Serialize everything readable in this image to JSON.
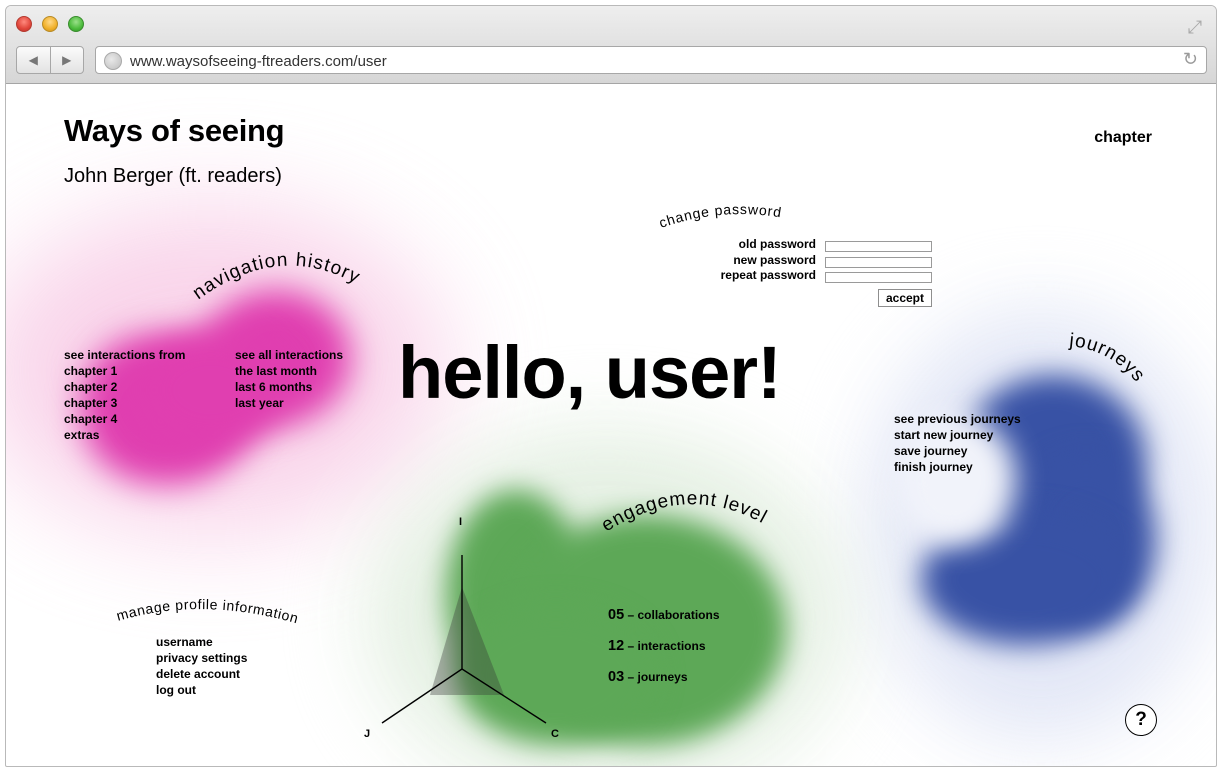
{
  "browser": {
    "url": "www.waysofseeing-ftreaders.com/user",
    "back_icon": "back-arrow-icon",
    "forward_icon": "forward-arrow-icon",
    "reload_icon": "reload-icon"
  },
  "site": {
    "title": "Ways of seeing",
    "subtitle": "John Berger (ft. readers)",
    "chapter_link": "chapter"
  },
  "greeting": "hello, user!",
  "navigation_history": {
    "heading": "navigation history",
    "from_label": "see interactions from",
    "chapters": [
      "chapter 1",
      "chapter 2",
      "chapter 3",
      "chapter 4",
      "extras"
    ],
    "all_label": "see all interactions",
    "periods": [
      "the last month",
      "last 6 months",
      "last year"
    ],
    "color": "#e03fb0"
  },
  "change_password": {
    "heading": "change password",
    "old_label": "old password",
    "new_label": "new password",
    "repeat_label": "repeat password",
    "accept_label": "accept"
  },
  "journeys": {
    "heading": "journeys",
    "items": [
      "see previous journeys",
      "start new journey",
      "save journey",
      "finish journey"
    ],
    "color": "#3852a5"
  },
  "engagement_level": {
    "heading": "engagement level",
    "stats": [
      {
        "value": "05",
        "label": "– collaborations"
      },
      {
        "value": "12",
        "label": "– interactions"
      },
      {
        "value": "03",
        "label": "– journeys"
      }
    ],
    "axes": [
      "I",
      "J",
      "C"
    ],
    "color": "#5da857"
  },
  "manage_profile": {
    "heading": "manage profile information",
    "items": [
      "username",
      "privacy settings",
      "delete account",
      "log out"
    ]
  },
  "help_label": "?"
}
